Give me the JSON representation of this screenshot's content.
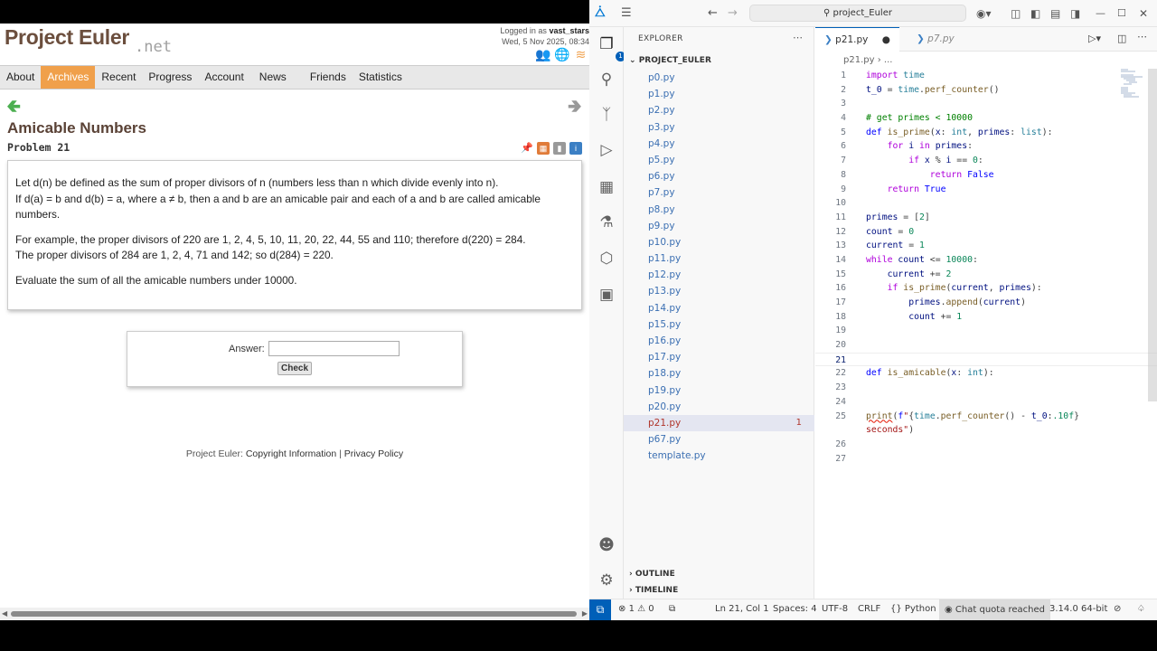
{
  "browser": {
    "logo_main": "Project Euler",
    "logo_net": ".net",
    "login_line1_prefix": "Logged in as",
    "login_user": "vast_stars",
    "login_line2": "Wed, 5 Nov 2025, 08:34",
    "nav": [
      "About",
      "Archives",
      "Recent",
      "Progress",
      "Account",
      "News",
      "Friends",
      "Statistics"
    ],
    "active_nav": "Archives",
    "problem_title": "Amicable Numbers",
    "problem_number": "Problem 21",
    "para1_line1": "Let d(n) be defined as the sum of proper divisors of n (numbers less than n which divide evenly into n).",
    "para1_line2": "If d(a) = b and d(b) = a, where a ≠ b, then a and b are an amicable pair and each of a and b are called amicable numbers.",
    "para2_line1": "For example, the proper divisors of 220 are 1, 2, 4, 5, 10, 11, 20, 22, 44, 55 and 110; therefore d(220) = 284.",
    "para2_line2": "The proper divisors of 284 are 1, 2, 4, 71 and 142; so d(284) = 220.",
    "para3": "Evaluate the sum of all the amicable numbers under 10000.",
    "answer_label": "Answer:",
    "answer_value": "",
    "check_label": "Check",
    "footer_prefix": "Project Euler:",
    "footer_link1": "Copyright Information",
    "footer_sep": "|",
    "footer_link2": "Privacy Policy"
  },
  "vscode": {
    "search_text": "project_Euler",
    "explorer_title": "EXPLORER",
    "folder_name": "PROJECT_EULER",
    "files": [
      "p0.py",
      "p1.py",
      "p2.py",
      "p3.py",
      "p4.py",
      "p5.py",
      "p6.py",
      "p7.py",
      "p8.py",
      "p9.py",
      "p10.py",
      "p11.py",
      "p12.py",
      "p13.py",
      "p14.py",
      "p15.py",
      "p16.py",
      "p17.py",
      "p18.py",
      "p19.py",
      "p20.py",
      "p21.py",
      "p67.py",
      "template.py"
    ],
    "active_file": "p21.py",
    "active_file_badge": "1",
    "source_control_badge": "1",
    "outline_label": "OUTLINE",
    "timeline_label": "TIMELINE",
    "tab_active": "p21.py",
    "tab_inactive": "p7.py",
    "breadcrumb_file": "p21.py",
    "breadcrumb_rest": "...",
    "status": {
      "errors": "1",
      "warnings": "0",
      "position": "Ln 21, Col 1",
      "spaces": "Spaces: 4",
      "encoding": "UTF-8",
      "eol": "CRLF",
      "language": "Python",
      "chat": "Chat quota reached",
      "version": "3.14.0 64-bit"
    }
  }
}
